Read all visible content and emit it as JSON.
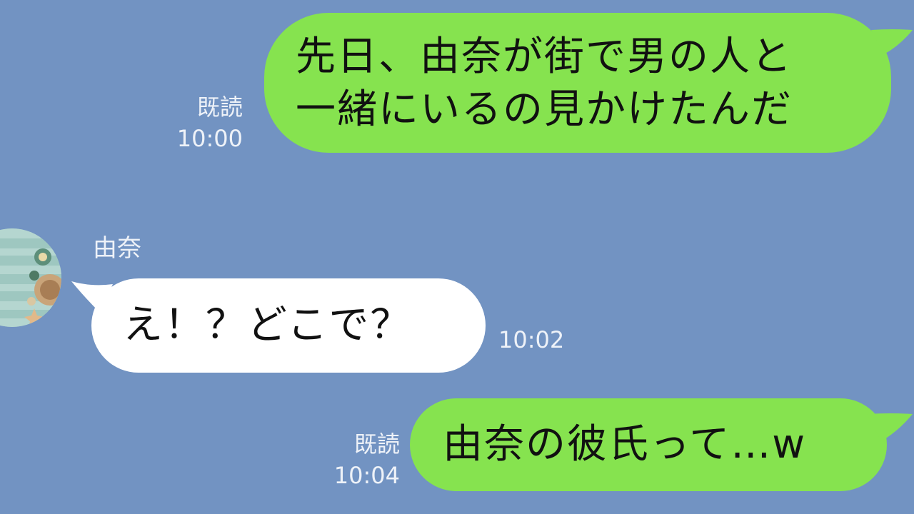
{
  "messages": [
    {
      "side": "sent",
      "lines": [
        "先日、由奈が街で男の人と",
        "一緒にいるの見かけたんだ"
      ],
      "read_label": "既読",
      "time": "10:00"
    },
    {
      "side": "received",
      "sender": "由奈",
      "lines": [
        "え！？どこで？"
      ],
      "time": "10:02"
    },
    {
      "side": "sent",
      "lines": [
        "由奈の彼氏って…w"
      ],
      "read_label": "既読",
      "time": "10:04"
    }
  ],
  "colors": {
    "background": "#7293c2",
    "sent_bubble": "#86e34f",
    "received_bubble": "#ffffff",
    "meta_text": "#eef2f8"
  },
  "icons": {
    "avatar": "seaside-photo-avatar"
  }
}
